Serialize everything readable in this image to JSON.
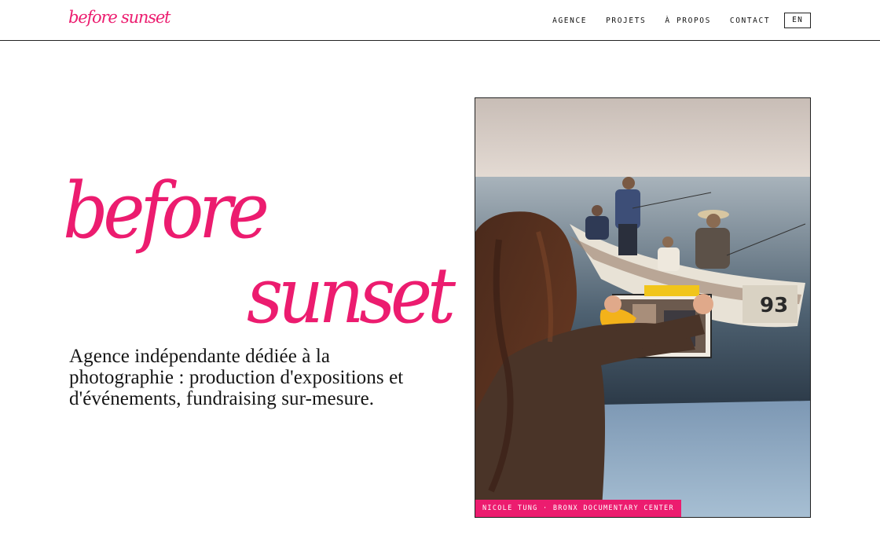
{
  "header": {
    "logo": "before sunset",
    "nav": [
      {
        "label": "AGENCE"
      },
      {
        "label": "PROJETS"
      },
      {
        "label": "À PROPOS"
      },
      {
        "label": "CONTACT"
      }
    ],
    "lang": "EN"
  },
  "hero": {
    "title_line1": "before",
    "title_line2": "sunset",
    "tagline": "Agence indépendante dédiée à la photographie : production d'expositions et d'événements, fundraising sur-mesure."
  },
  "photo": {
    "caption": "NICOLE TUNG · BRONX DOCUMENTARY CENTER",
    "boat_number": "93"
  },
  "colors": {
    "accent": "#ec1c6f",
    "text": "#111111",
    "background": "#ffffff"
  }
}
